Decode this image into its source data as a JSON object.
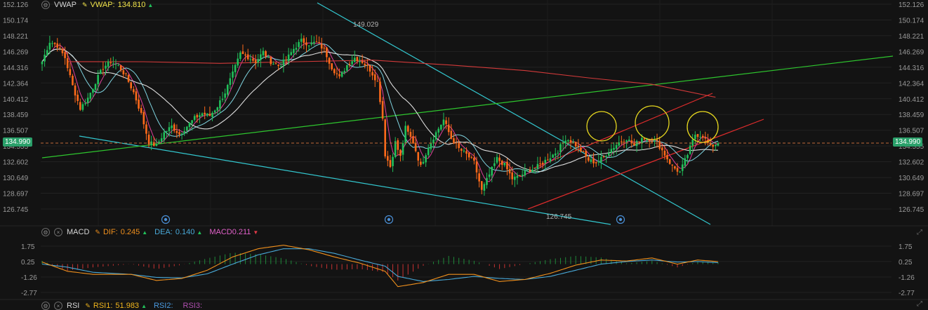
{
  "colors": {
    "background": "#131313",
    "grid": "#222222",
    "axis_text": "#9a9a9a",
    "up": "#21c05a",
    "down": "#ff6a1a",
    "vwap": "#f2e44a",
    "ma_magenta": "#e0409a",
    "ma_cyan": "#7fd4e0",
    "ma_white": "#dcdcdc",
    "ma_red": "#d23a3a",
    "trend_cyan": "#33c8d0",
    "trend_green": "#2ec62e",
    "trend_red": "#e02c2c",
    "circle": "#e7d81f",
    "last_price": "#2aa06a",
    "dif": "#f0901d",
    "dea": "#49a9d8",
    "macd_up": "#1f8a3a",
    "macd_down": "#c83232",
    "rsi1": "#f0b51d",
    "rsi2": "#4a9ae0",
    "rsi3": "#b04fb0"
  },
  "main": {
    "indicator": "VWAP",
    "vwap_label": "VWAP:",
    "vwap_value": "134.810",
    "axis_ticks": [
      "152.126",
      "150.174",
      "148.221",
      "146.269",
      "144.316",
      "142.364",
      "140.412",
      "138.459",
      "136.507",
      "134.555",
      "132.602",
      "130.649",
      "128.697",
      "126.745"
    ],
    "last_price": "134.990",
    "high_label": "149.029",
    "low_label": "126.745"
  },
  "macd": {
    "name": "MACD",
    "dif_label": "DIF:",
    "dif_value": "0.245",
    "dea_label": "DEA:",
    "dea_value": "0.140",
    "macd_label": "MACD",
    "macd_value": "0.211",
    "axis_ticks": [
      "1.75",
      "0.25",
      "-1.26",
      "-2.77"
    ]
  },
  "rsi": {
    "name": "RSI",
    "rsi1_label": "RSI1:",
    "rsi1_value": "51.983",
    "rsi2_label": "RSI2:",
    "rsi3_label": "RSI3:"
  },
  "chart_data": {
    "type": "candlestick",
    "yrange": [
      126.0,
      152.5
    ],
    "close_path": [
      {
        "i": 0,
        "v": 145.0
      },
      {
        "i": 3,
        "v": 147.5
      },
      {
        "i": 6,
        "v": 147.0
      },
      {
        "i": 9,
        "v": 145.5
      },
      {
        "i": 12,
        "v": 142.0
      },
      {
        "i": 15,
        "v": 139.2
      },
      {
        "i": 18,
        "v": 140.5
      },
      {
        "i": 21,
        "v": 142.5
      },
      {
        "i": 24,
        "v": 144.3
      },
      {
        "i": 27,
        "v": 145.0
      },
      {
        "i": 30,
        "v": 144.5
      },
      {
        "i": 33,
        "v": 143.2
      },
      {
        "i": 36,
        "v": 141.2
      },
      {
        "i": 39,
        "v": 138.5
      },
      {
        "i": 42,
        "v": 135.0
      },
      {
        "i": 45,
        "v": 134.6
      },
      {
        "i": 48,
        "v": 136.2
      },
      {
        "i": 51,
        "v": 137.0
      },
      {
        "i": 54,
        "v": 136.0
      },
      {
        "i": 57,
        "v": 137.0
      },
      {
        "i": 60,
        "v": 138.0
      },
      {
        "i": 63,
        "v": 138.6
      },
      {
        "i": 66,
        "v": 138.3
      },
      {
        "i": 69,
        "v": 139.5
      },
      {
        "i": 72,
        "v": 141.2
      },
      {
        "i": 75,
        "v": 143.5
      },
      {
        "i": 78,
        "v": 146.0
      },
      {
        "i": 81,
        "v": 145.6
      },
      {
        "i": 84,
        "v": 145.0
      },
      {
        "i": 87,
        "v": 146.2
      },
      {
        "i": 90,
        "v": 145.0
      },
      {
        "i": 93,
        "v": 144.5
      },
      {
        "i": 96,
        "v": 145.2
      },
      {
        "i": 99,
        "v": 146.6
      },
      {
        "i": 102,
        "v": 147.6
      },
      {
        "i": 105,
        "v": 147.2
      },
      {
        "i": 108,
        "v": 147.4
      },
      {
        "i": 111,
        "v": 146.5
      },
      {
        "i": 114,
        "v": 144.3
      },
      {
        "i": 117,
        "v": 143.0
      },
      {
        "i": 120,
        "v": 144.6
      },
      {
        "i": 123,
        "v": 145.5
      },
      {
        "i": 126,
        "v": 145.0
      },
      {
        "i": 129,
        "v": 144.0
      },
      {
        "i": 132,
        "v": 142.5
      },
      {
        "i": 134,
        "v": 138.0
      },
      {
        "i": 135,
        "v": 133.5
      },
      {
        "i": 137,
        "v": 132.0
      },
      {
        "i": 139,
        "v": 135.0
      },
      {
        "i": 141,
        "v": 133.2
      },
      {
        "i": 143,
        "v": 136.8
      },
      {
        "i": 146,
        "v": 135.0
      },
      {
        "i": 149,
        "v": 132.0
      },
      {
        "i": 152,
        "v": 134.5
      },
      {
        "i": 155,
        "v": 136.2
      },
      {
        "i": 158,
        "v": 137.8
      },
      {
        "i": 161,
        "v": 135.5
      },
      {
        "i": 164,
        "v": 134.2
      },
      {
        "i": 167,
        "v": 133.5
      },
      {
        "i": 170,
        "v": 132.5
      },
      {
        "i": 173,
        "v": 129.0
      },
      {
        "i": 176,
        "v": 131.0
      },
      {
        "i": 179,
        "v": 133.0
      },
      {
        "i": 182,
        "v": 132.2
      },
      {
        "i": 185,
        "v": 130.5
      },
      {
        "i": 188,
        "v": 130.8
      },
      {
        "i": 191,
        "v": 131.5
      },
      {
        "i": 194,
        "v": 131.8
      },
      {
        "i": 197,
        "v": 132.5
      },
      {
        "i": 200,
        "v": 133.2
      },
      {
        "i": 203,
        "v": 134.0
      },
      {
        "i": 206,
        "v": 135.5
      },
      {
        "i": 209,
        "v": 135.0
      },
      {
        "i": 212,
        "v": 134.0
      },
      {
        "i": 215,
        "v": 132.8
      },
      {
        "i": 218,
        "v": 132.5
      },
      {
        "i": 221,
        "v": 133.2
      },
      {
        "i": 224,
        "v": 134.2
      },
      {
        "i": 227,
        "v": 135.0
      },
      {
        "i": 230,
        "v": 135.5
      },
      {
        "i": 233,
        "v": 134.6
      },
      {
        "i": 236,
        "v": 135.6
      },
      {
        "i": 239,
        "v": 135.4
      },
      {
        "i": 242,
        "v": 135.0
      },
      {
        "i": 245,
        "v": 133.5
      },
      {
        "i": 248,
        "v": 132.0
      },
      {
        "i": 251,
        "v": 131.3
      },
      {
        "i": 254,
        "v": 133.5
      },
      {
        "i": 257,
        "v": 136.0
      },
      {
        "i": 260,
        "v": 135.8
      },
      {
        "i": 263,
        "v": 134.4
      },
      {
        "i": 266,
        "v": 135.0
      }
    ],
    "macd_dif_path": [
      {
        "i": 0,
        "v": 0.2
      },
      {
        "i": 10,
        "v": -0.7
      },
      {
        "i": 20,
        "v": -1.0
      },
      {
        "i": 35,
        "v": -1.0
      },
      {
        "i": 45,
        "v": -1.6
      },
      {
        "i": 55,
        "v": -1.4
      },
      {
        "i": 65,
        "v": -0.6
      },
      {
        "i": 75,
        "v": 0.7
      },
      {
        "i": 85,
        "v": 1.5
      },
      {
        "i": 95,
        "v": 1.85
      },
      {
        "i": 105,
        "v": 1.4
      },
      {
        "i": 115,
        "v": 0.7
      },
      {
        "i": 125,
        "v": 0.1
      },
      {
        "i": 135,
        "v": -0.7
      },
      {
        "i": 140,
        "v": -2.2
      },
      {
        "i": 150,
        "v": -1.8
      },
      {
        "i": 160,
        "v": -1.0
      },
      {
        "i": 170,
        "v": -1.0
      },
      {
        "i": 180,
        "v": -1.7
      },
      {
        "i": 190,
        "v": -1.5
      },
      {
        "i": 200,
        "v": -0.9
      },
      {
        "i": 210,
        "v": -0.1
      },
      {
        "i": 220,
        "v": 0.4
      },
      {
        "i": 230,
        "v": 0.3
      },
      {
        "i": 240,
        "v": 0.6
      },
      {
        "i": 250,
        "v": 0.0
      },
      {
        "i": 258,
        "v": 0.4
      },
      {
        "i": 266,
        "v": 0.245
      }
    ],
    "macd_dea_path": [
      {
        "i": 0,
        "v": 0.0
      },
      {
        "i": 10,
        "v": -0.3
      },
      {
        "i": 20,
        "v": -0.8
      },
      {
        "i": 35,
        "v": -1.0
      },
      {
        "i": 45,
        "v": -1.3
      },
      {
        "i": 55,
        "v": -1.35
      },
      {
        "i": 65,
        "v": -0.95
      },
      {
        "i": 75,
        "v": 0.0
      },
      {
        "i": 85,
        "v": 0.9
      },
      {
        "i": 95,
        "v": 1.5
      },
      {
        "i": 105,
        "v": 1.5
      },
      {
        "i": 115,
        "v": 1.05
      },
      {
        "i": 125,
        "v": 0.4
      },
      {
        "i": 135,
        "v": -0.2
      },
      {
        "i": 140,
        "v": -1.2
      },
      {
        "i": 150,
        "v": -1.7
      },
      {
        "i": 160,
        "v": -1.5
      },
      {
        "i": 170,
        "v": -1.2
      },
      {
        "i": 180,
        "v": -1.4
      },
      {
        "i": 190,
        "v": -1.5
      },
      {
        "i": 200,
        "v": -1.2
      },
      {
        "i": 210,
        "v": -0.6
      },
      {
        "i": 220,
        "v": 0.0
      },
      {
        "i": 230,
        "v": 0.25
      },
      {
        "i": 240,
        "v": 0.4
      },
      {
        "i": 250,
        "v": 0.2
      },
      {
        "i": 258,
        "v": 0.25
      },
      {
        "i": 266,
        "v": 0.14
      }
    ],
    "macd_range": [
      -3.0,
      2.1
    ],
    "annotations": [
      "149.029",
      "126.745"
    ]
  }
}
